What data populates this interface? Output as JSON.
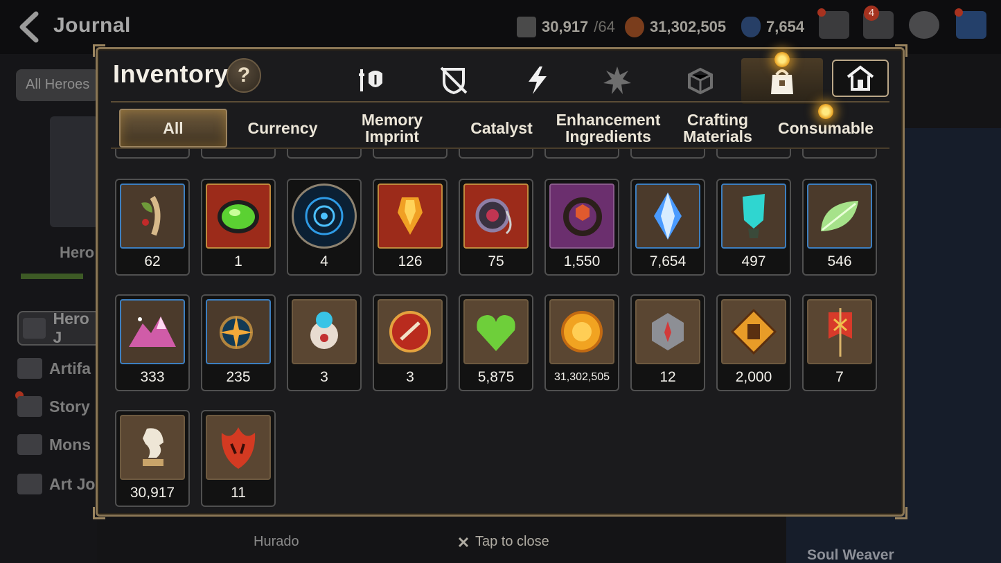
{
  "topbar": {
    "title": "Journal",
    "resources": [
      {
        "name": "skystone-icon",
        "value": "30,917",
        "sub": "/64",
        "color": "#c8c0b0"
      },
      {
        "name": "gold-icon",
        "value": "31,302,505",
        "sub": "",
        "color": "#c96a2c"
      },
      {
        "name": "crystal-icon",
        "value": "7,654",
        "sub": "",
        "color": "#4a7fd4"
      }
    ],
    "mail_badge": "4"
  },
  "background": {
    "all_heroes_label": "All Heroes",
    "hero_label": "Hero",
    "menu": [
      "Hero J",
      "Artifa",
      "Story",
      "Mons",
      "Art Jo"
    ],
    "hurado_label": "Hurado",
    "soul_weaver_label": "Soul Weaver",
    "tap_to_close": "Tap to close"
  },
  "modal": {
    "title": "Inventory",
    "help_label": "?",
    "category_icons": [
      "equipment-icon",
      "defense-icon",
      "artifact-icon",
      "spirit-icon",
      "box-icon",
      "bag-icon",
      "home-icon"
    ],
    "subtabs": [
      "All",
      "Currency",
      "Memory Imprint",
      "Catalyst",
      "Enhancement Ingredients",
      "Crafting Materials",
      "Consumable"
    ],
    "active_subtab": "All",
    "items": [
      {
        "icon": "herb-icon",
        "count": "62",
        "frame": "blue"
      },
      {
        "icon": "green-orb-icon",
        "count": "1",
        "frame": "red"
      },
      {
        "icon": "rune-circle-icon",
        "count": "4",
        "frame": "round"
      },
      {
        "icon": "flame-crystal-icon",
        "count": "126",
        "frame": "red"
      },
      {
        "icon": "amulet-icon",
        "count": "75",
        "frame": "red"
      },
      {
        "icon": "ring-icon",
        "count": "1,550",
        "frame": "purple"
      },
      {
        "icon": "blue-gem-icon",
        "count": "7,654",
        "frame": "blue"
      },
      {
        "icon": "teal-crystal-icon",
        "count": "497",
        "frame": "blue"
      },
      {
        "icon": "leaf-icon",
        "count": "546",
        "frame": "blue"
      },
      {
        "icon": "pink-mountain-icon",
        "count": "333",
        "frame": "blue"
      },
      {
        "icon": "star-compass-icon",
        "count": "235",
        "frame": "blue"
      },
      {
        "icon": "robot-orb-icon",
        "count": "3",
        "frame": "plain"
      },
      {
        "icon": "seal-badge-icon",
        "count": "3",
        "frame": "plain"
      },
      {
        "icon": "green-heart-icon",
        "count": "5,875",
        "frame": "plain"
      },
      {
        "icon": "gold-coin-icon",
        "count": "31,302,505",
        "frame": "plain"
      },
      {
        "icon": "stone-compass-icon",
        "count": "12",
        "frame": "plain"
      },
      {
        "icon": "fist-emblem-icon",
        "count": "2,000",
        "frame": "plain"
      },
      {
        "icon": "banner-icon",
        "count": "7",
        "frame": "plain"
      },
      {
        "icon": "knight-piece-icon",
        "count": "30,917",
        "frame": "plain"
      },
      {
        "icon": "red-leaf-icon",
        "count": "11",
        "frame": "plain"
      }
    ]
  }
}
